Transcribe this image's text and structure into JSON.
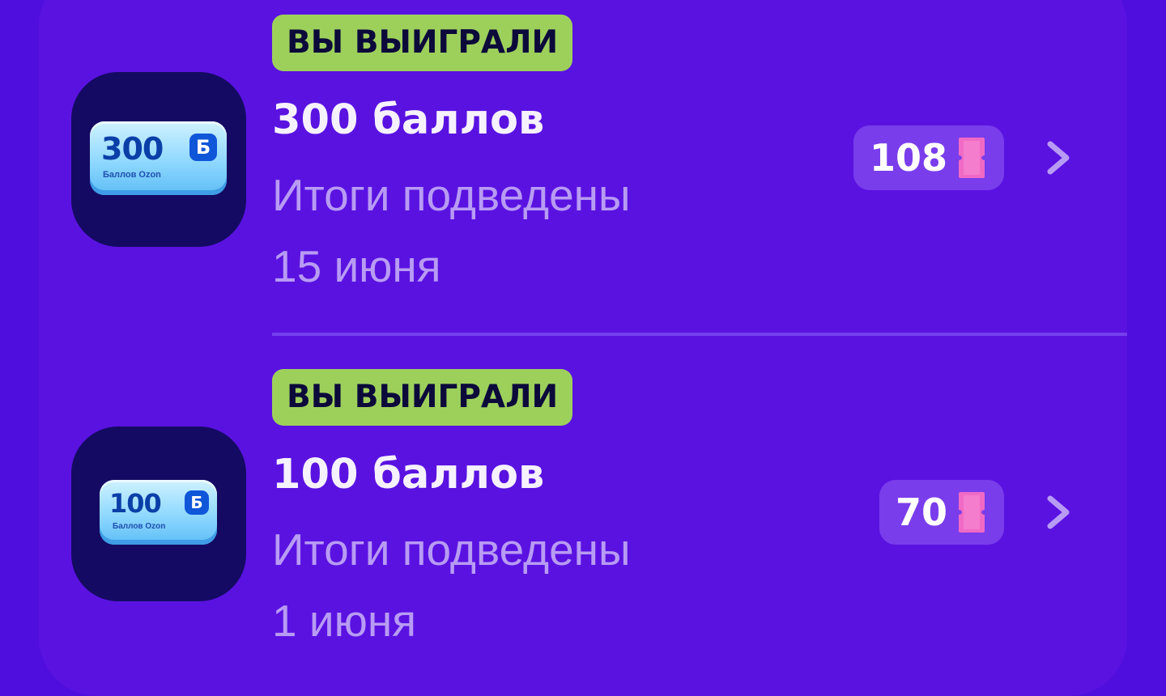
{
  "prizes": [
    {
      "badge": "ВЫ ВЫИГРАЛИ",
      "title": "300 баллов",
      "status": "Итоги подведены",
      "date": "15 июня",
      "tickets": "108",
      "coin": {
        "value": "300",
        "currency": "Б",
        "caption": "Баллов Ozon"
      }
    },
    {
      "badge": "ВЫ ВЫИГРАЛИ",
      "title": "100 баллов",
      "status": "Итоги подведены",
      "date": "1 июня",
      "tickets": "70",
      "coin": {
        "value": "100",
        "currency": "Б",
        "caption": "Баллов Ozon"
      }
    }
  ],
  "colors": {
    "background": "#4F0EDD",
    "card": "#5A12E1",
    "badge": "#9DD05B",
    "muted_text": "#B89BF4",
    "ticket_pink": "#F06AC4",
    "thumb": "#140A63"
  },
  "icons": {
    "ticket": "ticket-icon",
    "chevron": "chevron-right-icon"
  }
}
